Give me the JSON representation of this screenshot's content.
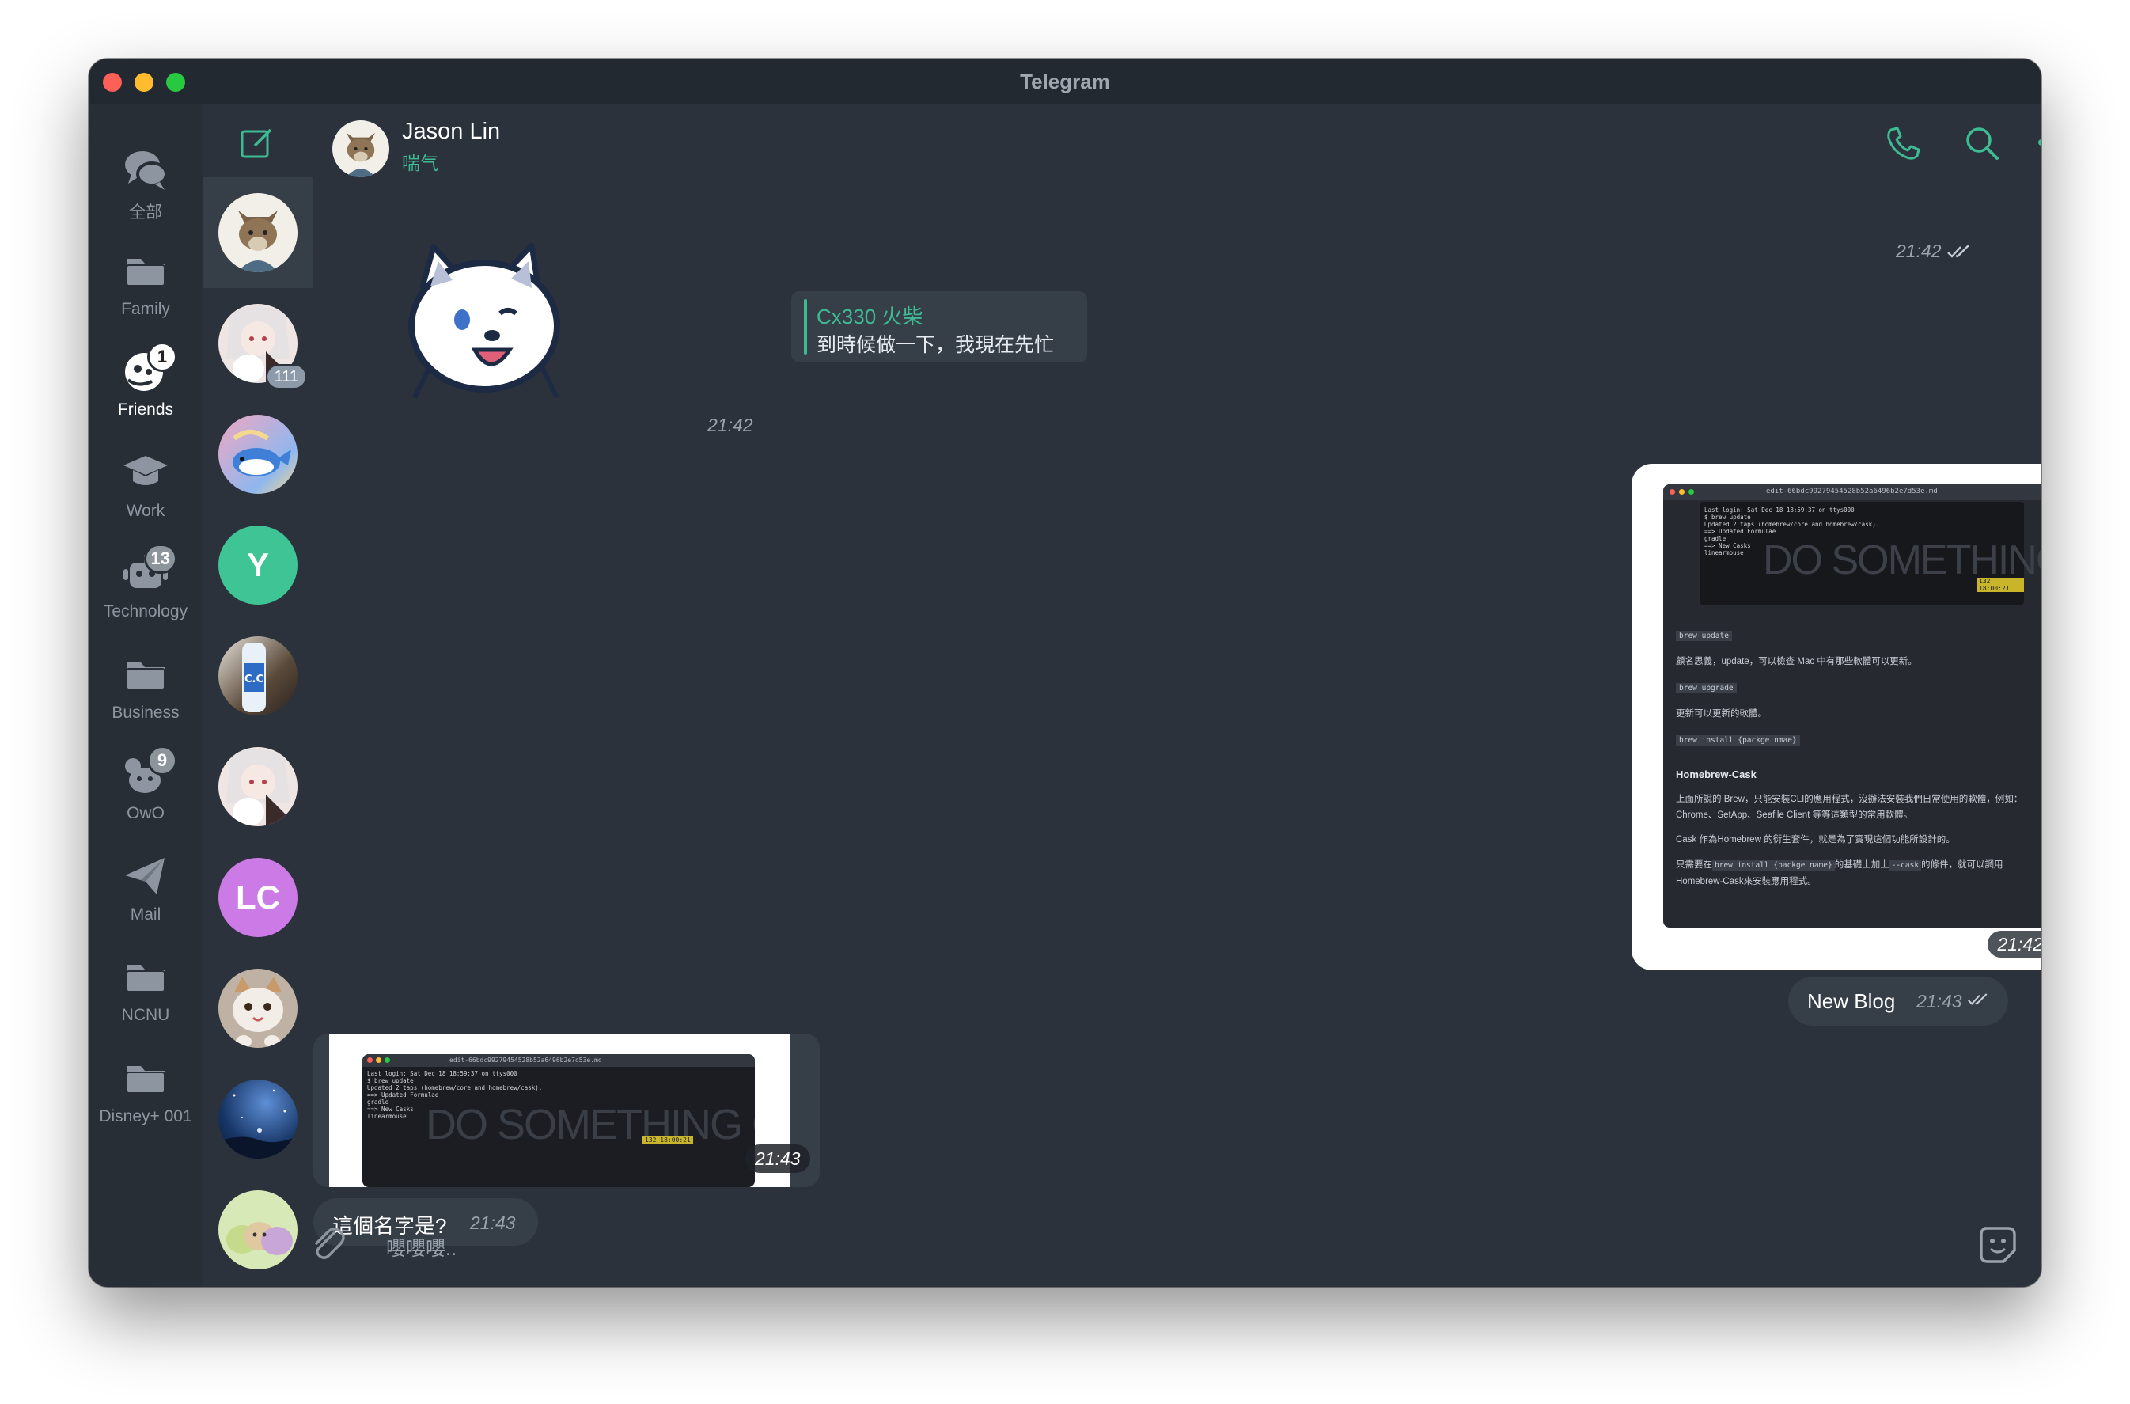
{
  "window": {
    "title": "Telegram"
  },
  "folders": [
    {
      "name": "全部",
      "icon": "chat-bubbles-icon",
      "badge": ""
    },
    {
      "name": "Family",
      "icon": "folder-icon",
      "badge": ""
    },
    {
      "name": "Friends",
      "icon": "friends-icon",
      "badge": "1"
    },
    {
      "name": "Work",
      "icon": "graduation-cap-icon",
      "badge": ""
    },
    {
      "name": "Technology",
      "icon": "robot-icon",
      "badge": "13"
    },
    {
      "name": "Business",
      "icon": "folder-icon",
      "badge": ""
    },
    {
      "name": "OwO",
      "icon": "mouse-icon",
      "badge": "9"
    },
    {
      "name": "Mail",
      "icon": "paper-plane-icon",
      "badge": ""
    },
    {
      "name": "NCNU",
      "icon": "folder-icon",
      "badge": ""
    },
    {
      "name": "Disney+ 001",
      "icon": "folder-icon",
      "badge": ""
    }
  ],
  "chat_list": [
    {
      "avatar": "wolf-avatar",
      "badge": "",
      "letters": ""
    },
    {
      "avatar": "anime-girl-avatar",
      "badge": "111",
      "letters": ""
    },
    {
      "avatar": "whale-avatar",
      "badge": "",
      "letters": ""
    },
    {
      "avatar": "letter-avatar",
      "badge": "",
      "letters": "Y"
    },
    {
      "avatar": "cc-lemon-avatar",
      "badge": "",
      "letters": ""
    },
    {
      "avatar": "anime-girl-avatar-2",
      "badge": "",
      "letters": ""
    },
    {
      "avatar": "letter-avatar",
      "badge": "",
      "letters": "LC"
    },
    {
      "avatar": "cat-avatar",
      "badge": "",
      "letters": ""
    },
    {
      "avatar": "night-sky-avatar",
      "badge": "",
      "letters": ""
    },
    {
      "avatar": "dumplings-avatar",
      "badge": "",
      "letters": ""
    }
  ],
  "header": {
    "name": "Jason Lin",
    "status": "喘气"
  },
  "messages": {
    "top_time": "21:42",
    "sticker_time": "21:42",
    "reply_name": "Cx330 火柴",
    "reply_text": "到時候做一下，我現在先忙",
    "image_out_time": "21:42",
    "out_text": "New Blog",
    "out_text_time": "21:43",
    "image_in_time": "21:43",
    "in_text": "這個名字是?",
    "in_text_time": "21:43"
  },
  "blog_shot": {
    "window_title": "edit-66bdc99279454528b52a6496b2e7d53e.md",
    "terminal_lines": [
      "Last login: Sat Dec 18 18:59:37 on ttys000",
      "$ brew update",
      "Updated 2 taps (homebrew/core and homebrew/cask).",
      "==> Updated Formulae",
      "gradle",
      "==> New Casks",
      "linearmouse"
    ],
    "terminal_banner": "DO SOMETHING GREAT",
    "status_chip": "132 18:00:21",
    "code_update": "brew update",
    "text_update": "顧名思義，update，可以檢查 Mac 中有那些軟體可以更新。",
    "code_upgrade": "brew upgrade",
    "text_upgrade": "更新可以更新的軟體。",
    "code_install": "brew install {packge nmae}",
    "section_title": "Homebrew-Cask",
    "para_1": "上面所說的 Brew，只能安裝CLI的應用程式，沒辦法安裝我們日常使用的軟體，例如：Chrome、SetApp、Seafile Client 等等這類型的常用軟體。",
    "para_2": "Cask 作為Homebrew 的衍生套件，就是為了實現這個功能所設計的。",
    "para_3a": "只需要在",
    "para_3_code": "brew install {packge name}",
    "para_3b": "的基礎上加上",
    "para_3_code2": "--cask",
    "para_3c": "的條件，就可以調用Homebrew-Cask來安裝應用程式。"
  },
  "input": {
    "placeholder": "嚶嚶嚶.."
  },
  "colors": {
    "accent": "#3fbb94",
    "bg": "#2b323b",
    "bubble": "#363e48"
  }
}
